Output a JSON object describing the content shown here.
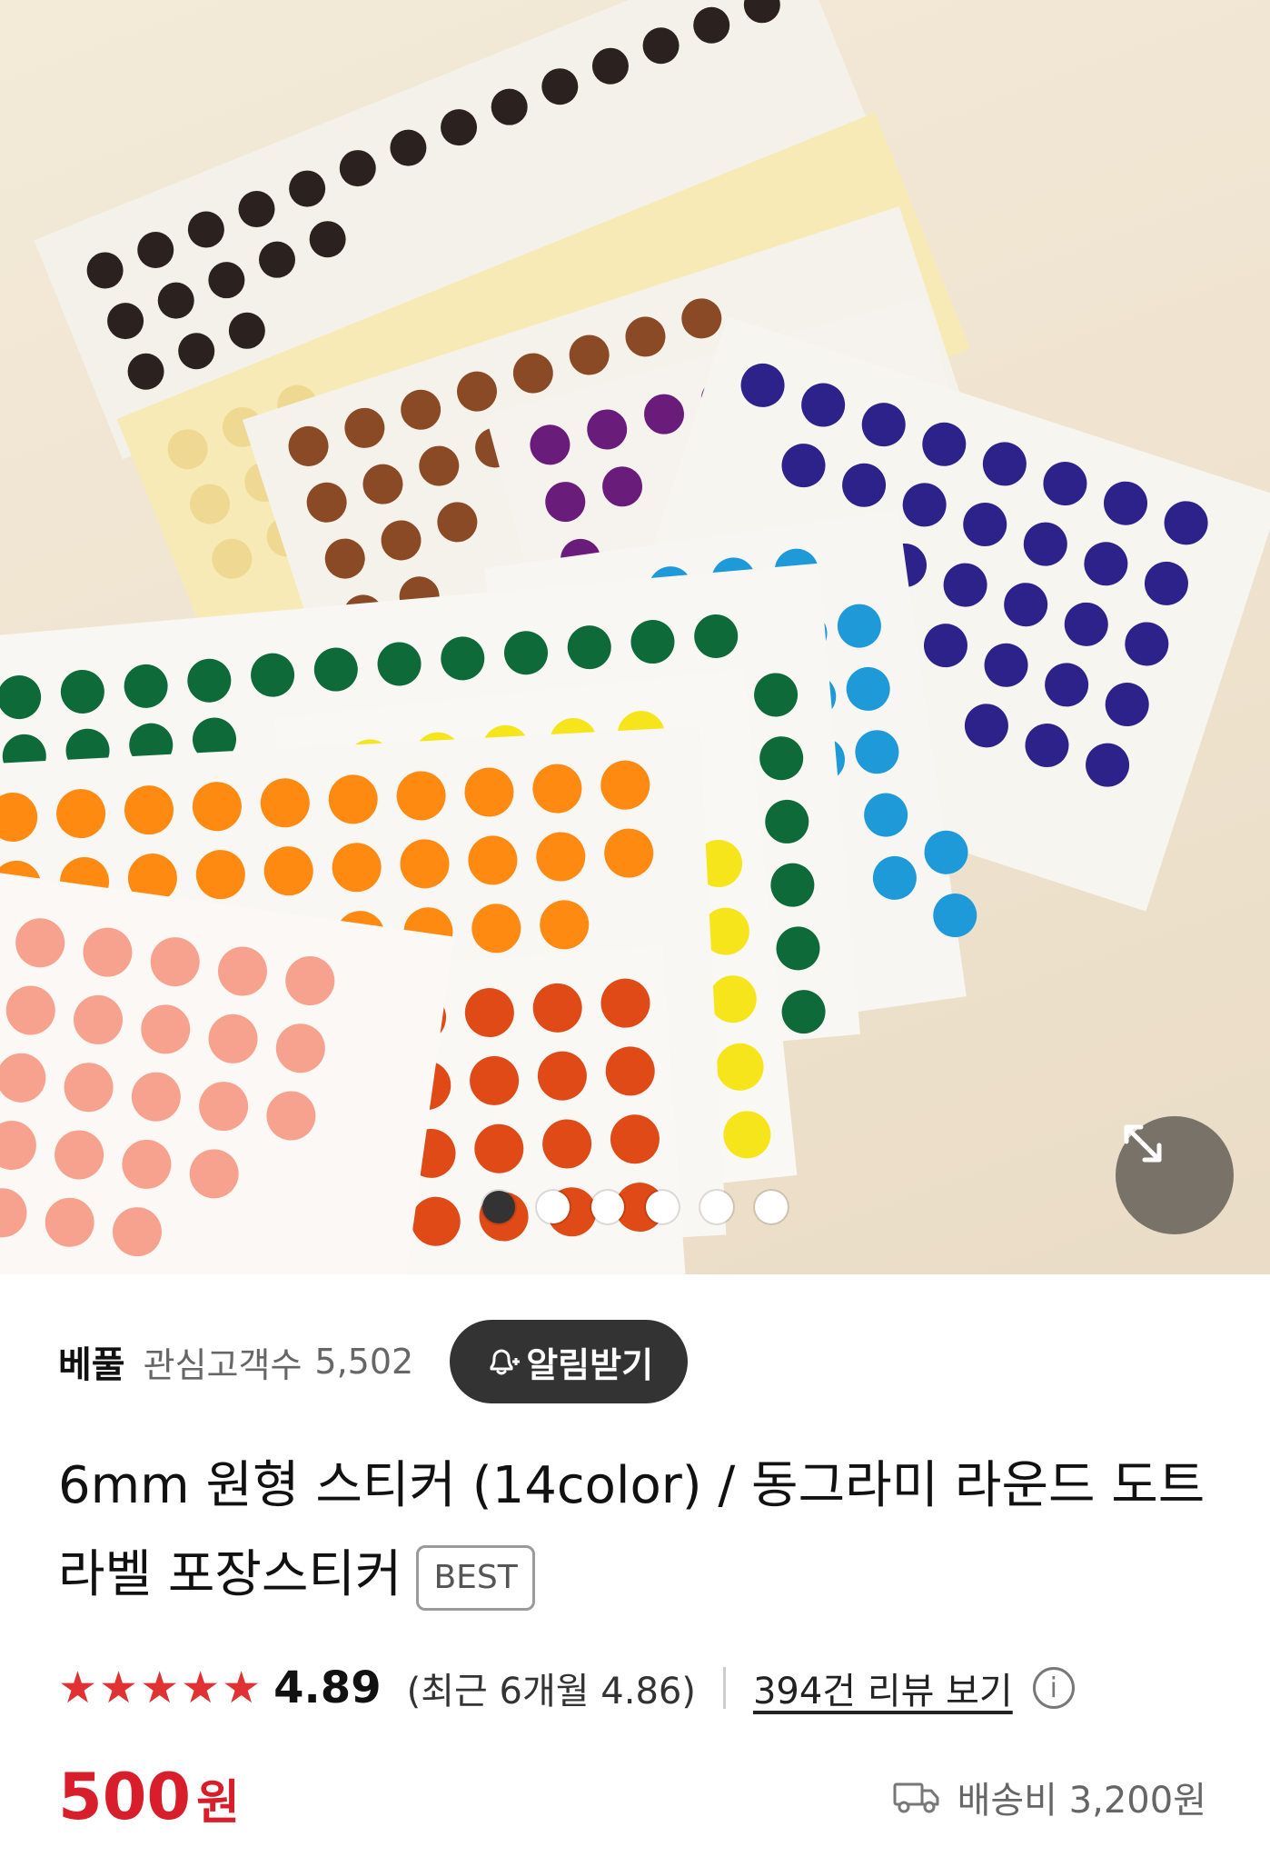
{
  "hero": {
    "pagination": {
      "count": 6,
      "active_index": 0
    }
  },
  "seller": {
    "name": "베풀",
    "interest_label": "관심고객수",
    "interest_count": "5,502",
    "notify_label": "알림받기"
  },
  "product": {
    "title": "6mm 원형 스티커 (14color) / 동그라미 라운드 도트 라벨 포장스티커",
    "badge": "BEST"
  },
  "rating": {
    "stars": 5,
    "score": "4.89",
    "recent_text": "(최근 6개월 4.86)",
    "review_link": "394건 리뷰 보기"
  },
  "price": {
    "amount": "500",
    "unit": "원"
  },
  "shipping": {
    "text": "배송비 3,200원"
  },
  "colors": {
    "price_red": "#d81e2a",
    "star_red": "#e03232",
    "button_dark": "#333333"
  }
}
